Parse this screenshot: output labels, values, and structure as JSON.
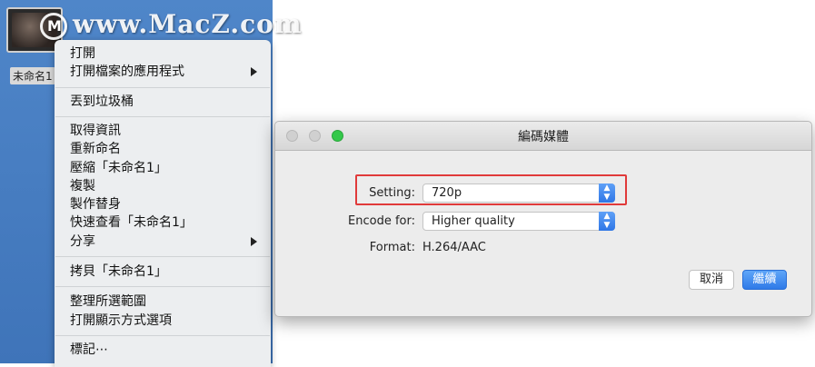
{
  "desktop": {
    "file_label": "未命名1"
  },
  "watermark": {
    "logo_letter": "M",
    "text": "www.MacZ.com"
  },
  "context_menu": {
    "items": [
      {
        "label": "打開"
      },
      {
        "label": "打開檔案的應用程式",
        "submenu": true
      },
      {
        "label": "丟到垃圾桶"
      },
      {
        "label": "取得資訊"
      },
      {
        "label": "重新命名"
      },
      {
        "label": "壓縮「未命名1」"
      },
      {
        "label": "複製"
      },
      {
        "label": "製作替身"
      },
      {
        "label": "快速查看「未命名1」"
      },
      {
        "label": "分享",
        "submenu": true
      },
      {
        "label": "拷貝「未命名1」"
      },
      {
        "label": "整理所選範圍"
      },
      {
        "label": "打開顯示方式選項"
      },
      {
        "label": "標記⋯"
      }
    ]
  },
  "dialog": {
    "title": "編碼媒體",
    "setting_label": "Setting:",
    "setting_value": "720p",
    "encode_label": "Encode for:",
    "encode_value": "Higher quality",
    "format_label": "Format:",
    "format_value": "H.264/AAC",
    "cancel_label": "取消",
    "continue_label": "繼續"
  },
  "icons": {
    "stepper_up": "▲",
    "stepper_down": "▼"
  },
  "colors": {
    "desktop_blue": "#3f74b9",
    "highlight_red": "#e03a3a",
    "accent_blue": "#2f7ae8",
    "zoom_green": "#34c84a"
  }
}
